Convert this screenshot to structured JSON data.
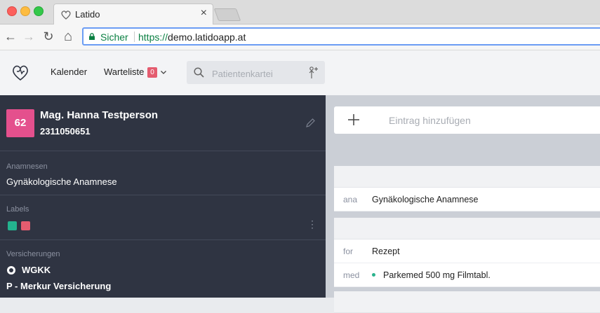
{
  "browser": {
    "tab_title": "Latido",
    "tab_close": "×",
    "secure_label": "Sicher",
    "url_protocol": "https://",
    "url_host": "demo.latidoapp.at",
    "nav_back": "←",
    "nav_forward": "→",
    "nav_reload": "↻",
    "nav_home": "⌂"
  },
  "header": {
    "nav": {
      "calendar": "Kalender",
      "waitlist": "Warteliste",
      "waitlist_count": "0"
    },
    "search": {
      "placeholder": "Patientenkartei"
    }
  },
  "patient": {
    "avatar_number": "62",
    "name": "Mag. Hanna Testperson",
    "id": "2311050651",
    "anamnesen_label": "Anamnesen",
    "anamnesen_value": "Gynäkologische Anamnese",
    "labels_label": "Labels",
    "label_colors": [
      "#23b38e",
      "#e45c6f"
    ],
    "kebab": "⋮",
    "insurance_label": "Versicherungen",
    "insurance_primary": "WGKK",
    "insurance_secondary": "P - Merkur Versicherung"
  },
  "main": {
    "add_entry_label": "Eintrag hinzufügen",
    "entries": [
      {
        "type": "ana",
        "text": "Gynäkologische Anamnese"
      },
      {
        "type": "for",
        "text": "Rezept"
      },
      {
        "type": "med",
        "text": "Parkemed 500 mg Filmtabl."
      }
    ]
  },
  "colors": {
    "accent_pink": "#e4508d",
    "badge_red": "#e45c6f",
    "sidebar_bg": "#2f3442",
    "secure_green": "#0b8043"
  }
}
